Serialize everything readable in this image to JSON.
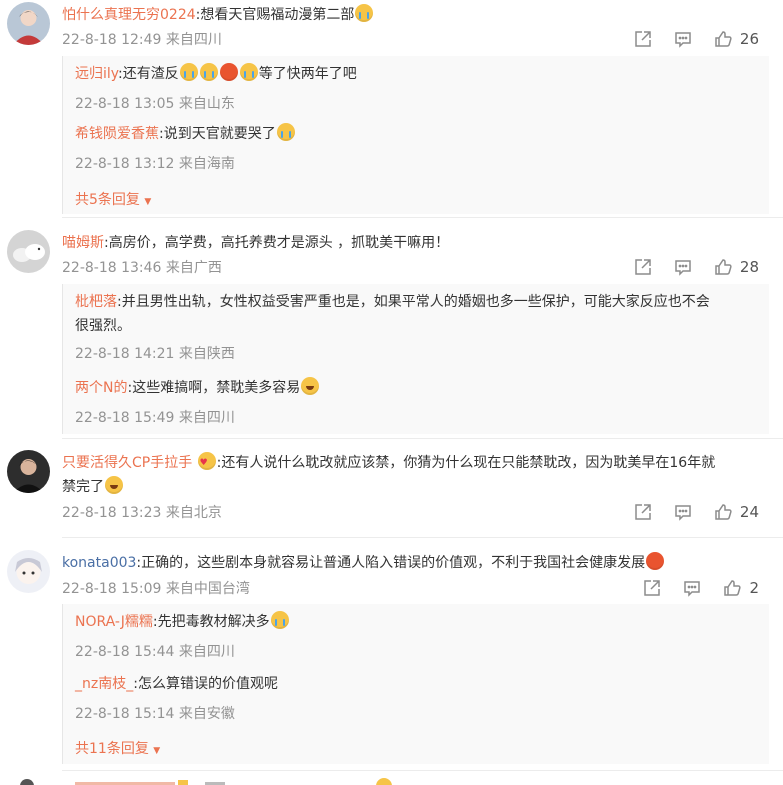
{
  "comments": [
    {
      "name": "怕什么真理无穷0224",
      "text": ":想看天官赐福动漫第二部",
      "emoji": "cry",
      "time": "22-8-18 12:49 来自四川",
      "likes": "26",
      "avatar_color": "#b9c7d6",
      "replies": [
        {
          "name": "远归ily",
          "text_before": ":还有渣反",
          "emojis": [
            "cry",
            "cry",
            "cry",
            "cry"
          ],
          "text_after": "等了快两年了吧",
          "time": "22-8-18 13:05 来自山东"
        },
        {
          "name": "希钱陨爱香蕉",
          "text_before": ":说到天官就要哭了",
          "emojis": [
            "cry"
          ],
          "text_after": "",
          "time": "22-8-18 13:12 来自海南"
        }
      ],
      "more": "共5条回复"
    },
    {
      "name": "喵姆斯",
      "text": ":高房价，高学费，高托养费才是源头 ，抓耽美干嘛用！",
      "time": "22-8-18 13:46 来自广西",
      "likes": "28",
      "avatar_color": "#c8c8c8",
      "replies": [
        {
          "name": "枇杷落",
          "text_line1": ":并且男性出轨，女性权益受害严重也是，如果平常人的婚姻也多一些保护，可能大家反应也不会",
          "text_line2": "很强烈。",
          "time": "22-8-18 14:21 来自陕西"
        },
        {
          "name": "两个N的",
          "text_before": ":这些难搞啊，禁耽美多容易",
          "emojis": [
            "laugh"
          ],
          "text_after": "",
          "time": "22-8-18 15:49 来自四川"
        }
      ]
    },
    {
      "name": "只要活得久CP手拉手",
      "text_line1": ":还有人说什么耽改就应该禁，你猜为什么现在只能禁耽改，因为耽美早在16年就",
      "text_line2": "禁完了",
      "time": "22-8-18 13:23 来自北京",
      "likes": "24",
      "avatar_color": "#3a3a3a"
    },
    {
      "name": "konata003",
      "text": ":正确的，这些剧本身就容易让普通人陷入错误的价值观，不利于我国社会健康发展",
      "time": "22-8-18 15:09 来自中国台湾",
      "likes": "2",
      "avatar_color": "#e9e4f2",
      "replies": [
        {
          "name": "NORA-J糯糯",
          "text_before": ":先把毒教材解决多",
          "emojis": [
            "cry"
          ],
          "text_after": "",
          "time": "22-8-18 15:44 来自四川"
        },
        {
          "name": "_nz南枝_",
          "text_before": ":怎么算错误的价值观呢",
          "emojis": [],
          "text_after": "",
          "time": "22-8-18 15:14 来自安徽"
        }
      ],
      "more": "共11条回复"
    }
  ],
  "colors": {
    "name": "#eb7350",
    "meta": "#939393",
    "text": "#333333"
  },
  "icons": {
    "share": "share-icon",
    "comment": "comment-icon",
    "like": "thumbs-up-icon",
    "chevron": "chevron-down-icon"
  }
}
